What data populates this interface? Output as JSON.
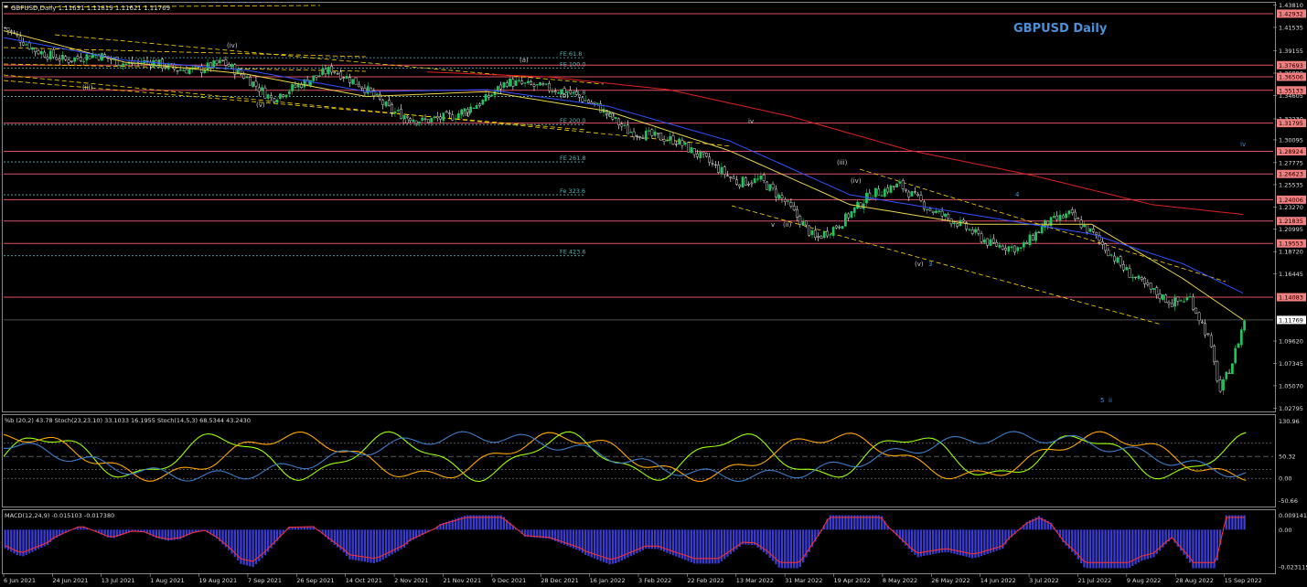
{
  "header": {
    "symbol_line": "GBPUSD,Daily  1.11631 1.11819 1.11621 1.11769",
    "watermark": "GBPUSD Daily"
  },
  "colors": {
    "background": "#000000",
    "bull_candle": "#22c55e",
    "bear_candle": "#ffffff",
    "ma_fast": "#e8d44d",
    "ma_mid": "#3050ff",
    "ma_slow": "#e02020",
    "horizontal_level": "#e05060",
    "fib_level": "#5fb3b3",
    "channel": "#ffd700",
    "price_tag_bg": "#f08080",
    "stoch_fast": "#9aff00",
    "stoch_slow": "#ffa500",
    "bb_pct": "#3a7cc8",
    "macd_hist": "#3b3bd0",
    "macd_signal": "#ff3030"
  },
  "chart_data": [
    {
      "type": "candlestick",
      "title": "GBPUSD Daily",
      "x_ticks": [
        "6 Jun 2021",
        "24 Jun 2021",
        "13 Jul 2021",
        "1 Aug 2021",
        "19 Aug 2021",
        "7 Sep 2021",
        "26 Sep 2021",
        "14 Oct 2021",
        "2 Nov 2021",
        "21 Nov 2021",
        "9 Dec 2021",
        "28 Dec 2021",
        "16 Jan 2022",
        "3 Feb 2022",
        "22 Feb 2022",
        "13 Mar 2022",
        "31 Mar 2022",
        "19 Apr 2022",
        "8 May 2022",
        "26 May 2022",
        "14 Jun 2022",
        "3 Jul 2022",
        "21 Jul 2022",
        "9 Aug 2022",
        "28 Aug 2022",
        "15 Sep 2022"
      ],
      "y_ticks": [
        "1.43810",
        "1.41535",
        "1.39155",
        "1.36880",
        "1.34605",
        "1.32230",
        "1.30095",
        "1.27775",
        "1.25535",
        "1.23270",
        "1.20995",
        "1.18720",
        "1.16445",
        "1.09620",
        "1.07345",
        "1.05070",
        "1.02795"
      ],
      "ylim": [
        1.0255,
        1.4395
      ],
      "price_track": [
        [
          0,
          1.415
        ],
        [
          10,
          1.392
        ],
        [
          20,
          1.382
        ],
        [
          30,
          1.388
        ],
        [
          40,
          1.378
        ],
        [
          48,
          1.381
        ],
        [
          56,
          1.373
        ],
        [
          64,
          1.372
        ],
        [
          72,
          1.38
        ],
        [
          80,
          1.364
        ],
        [
          88,
          1.343
        ],
        [
          98,
          1.358
        ],
        [
          108,
          1.373
        ],
        [
          118,
          1.356
        ],
        [
          128,
          1.33
        ],
        [
          138,
          1.32
        ],
        [
          148,
          1.325
        ],
        [
          158,
          1.34
        ],
        [
          166,
          1.36
        ],
        [
          176,
          1.355
        ],
        [
          186,
          1.35
        ],
        [
          196,
          1.335
        ],
        [
          206,
          1.31
        ],
        [
          214,
          1.305
        ],
        [
          222,
          1.3
        ],
        [
          232,
          1.28
        ],
        [
          242,
          1.258
        ],
        [
          250,
          1.26
        ],
        [
          258,
          1.238
        ],
        [
          268,
          1.2
        ],
        [
          276,
          1.215
        ],
        [
          286,
          1.245
        ],
        [
          296,
          1.255
        ],
        [
          306,
          1.23
        ],
        [
          316,
          1.215
        ],
        [
          326,
          1.195
        ],
        [
          336,
          1.19
        ],
        [
          344,
          1.215
        ],
        [
          352,
          1.225
        ],
        [
          360,
          1.205
        ],
        [
          370,
          1.17
        ],
        [
          378,
          1.15
        ],
        [
          386,
          1.135
        ],
        [
          392,
          1.14
        ],
        [
          398,
          1.1
        ],
        [
          402,
          1.045
        ],
        [
          406,
          1.075
        ],
        [
          410,
          1.118
        ]
      ],
      "price_x_unit": "trading bars since 6 Jun 2021",
      "moving_averages": [
        {
          "name": "MA fast",
          "track": [
            [
              0,
              1.412
            ],
            [
              40,
              1.38
            ],
            [
              80,
              1.368
            ],
            [
              120,
              1.345
            ],
            [
              160,
              1.35
            ],
            [
              200,
              1.33
            ],
            [
              240,
              1.29
            ],
            [
              280,
              1.235
            ],
            [
              320,
              1.215
            ],
            [
              360,
              1.215
            ],
            [
              390,
              1.16
            ],
            [
              410,
              1.118
            ]
          ]
        },
        {
          "name": "MA mid",
          "track": [
            [
              0,
              1.405
            ],
            [
              40,
              1.382
            ],
            [
              80,
              1.372
            ],
            [
              120,
              1.35
            ],
            [
              160,
              1.352
            ],
            [
              200,
              1.335
            ],
            [
              240,
              1.3
            ],
            [
              280,
              1.245
            ],
            [
              320,
              1.225
            ],
            [
              360,
              1.205
            ],
            [
              390,
              1.175
            ],
            [
              410,
              1.145
            ]
          ]
        },
        {
          "name": "MA slow",
          "track": [
            [
              140,
              1.37
            ],
            [
              180,
              1.365
            ],
            [
              220,
              1.352
            ],
            [
              260,
              1.325
            ],
            [
              300,
              1.29
            ],
            [
              340,
              1.265
            ],
            [
              380,
              1.235
            ],
            [
              410,
              1.225
            ]
          ]
        }
      ],
      "levels": [
        {
          "price": 1.42932,
          "label": "1.42932"
        },
        {
          "price": 1.37693,
          "label": "1.37693"
        },
        {
          "price": 1.36506,
          "label": "1.36506"
        },
        {
          "price": 1.35133,
          "label": "1.35133"
        },
        {
          "price": 1.31795,
          "label": "1.31795"
        },
        {
          "price": 1.28924,
          "label": "1.28924"
        },
        {
          "price": 1.26623,
          "label": "1.26623"
        },
        {
          "price": 1.24006,
          "label": "1.24006"
        },
        {
          "price": 1.21835,
          "label": "1.21835"
        },
        {
          "price": 1.19553,
          "label": "1.19553"
        },
        {
          "price": 1.14083,
          "label": "1.14083"
        }
      ],
      "current_price": {
        "price": 1.11769,
        "label": "1.11769"
      },
      "fib_levels": [
        {
          "price": 1.3845,
          "label": "FE 61.8"
        },
        {
          "price": 1.374,
          "label": "FE 100.0"
        },
        {
          "price": 1.345,
          "label": "FE 161.8"
        },
        {
          "price": 1.3165,
          "label": "FE 200.0"
        },
        {
          "price": 1.2785,
          "label": "FE 261.8"
        },
        {
          "price": 1.245,
          "label": "Fe 323.6"
        },
        {
          "price": 1.183,
          "label": "FE 423.6"
        }
      ],
      "wave_labels": [
        "(iii)",
        "(iv)",
        "(v)",
        "(i)",
        "(ii)",
        "(a)",
        "(b)",
        "(c)",
        "iv",
        "v",
        "(ii)",
        "(iii)",
        "(iv)",
        "(v)",
        "3",
        "4",
        "5",
        "ii",
        "iv"
      ]
    },
    {
      "type": "line",
      "title": "%b (20,2) 43.78  Stoch(23,23,10) 33.1033 16.1955  Stoch(14,5,3) 68.5344 43.2430",
      "y_ticks": [
        "130.96",
        "50.32",
        "0.00",
        "-50.66"
      ],
      "ylim": [
        -60,
        140
      ],
      "ref_levels": [
        80,
        50,
        20,
        0
      ]
    },
    {
      "type": "bar",
      "title": "MACD(12,24,9) -0.015103 -0.017380",
      "y_ticks": [
        "0.009141",
        "0.00",
        "-0.023115"
      ],
      "ylim": [
        -0.026,
        0.011
      ]
    }
  ]
}
